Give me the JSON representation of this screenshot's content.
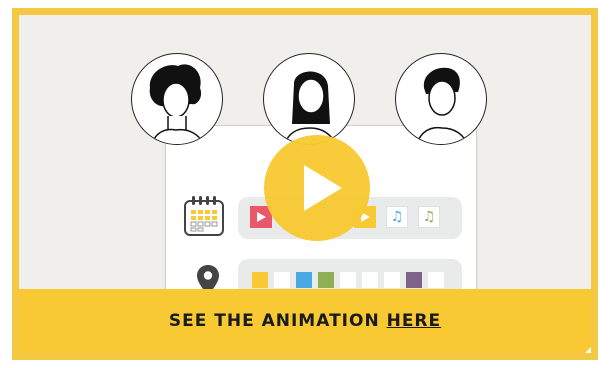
{
  "banner": {
    "lead": "SEE THE ANIMATION",
    "link": "HERE"
  },
  "colors": {
    "frame": "#f4c842",
    "banner": "#f8c932",
    "play": "#f8c932",
    "background": "#f0efeb",
    "tile_red": "#e8586a",
    "tile_yellow": "#f8c932",
    "tile_blue": "#4aa9e0",
    "tile_green": "#8fae55",
    "tile_purple": "#7d6387"
  },
  "icons": {
    "calendar": "calendar-icon",
    "location": "location-pin-icon",
    "play": "play-icon",
    "music": "music-note-icon",
    "video": "video-play-icon"
  }
}
